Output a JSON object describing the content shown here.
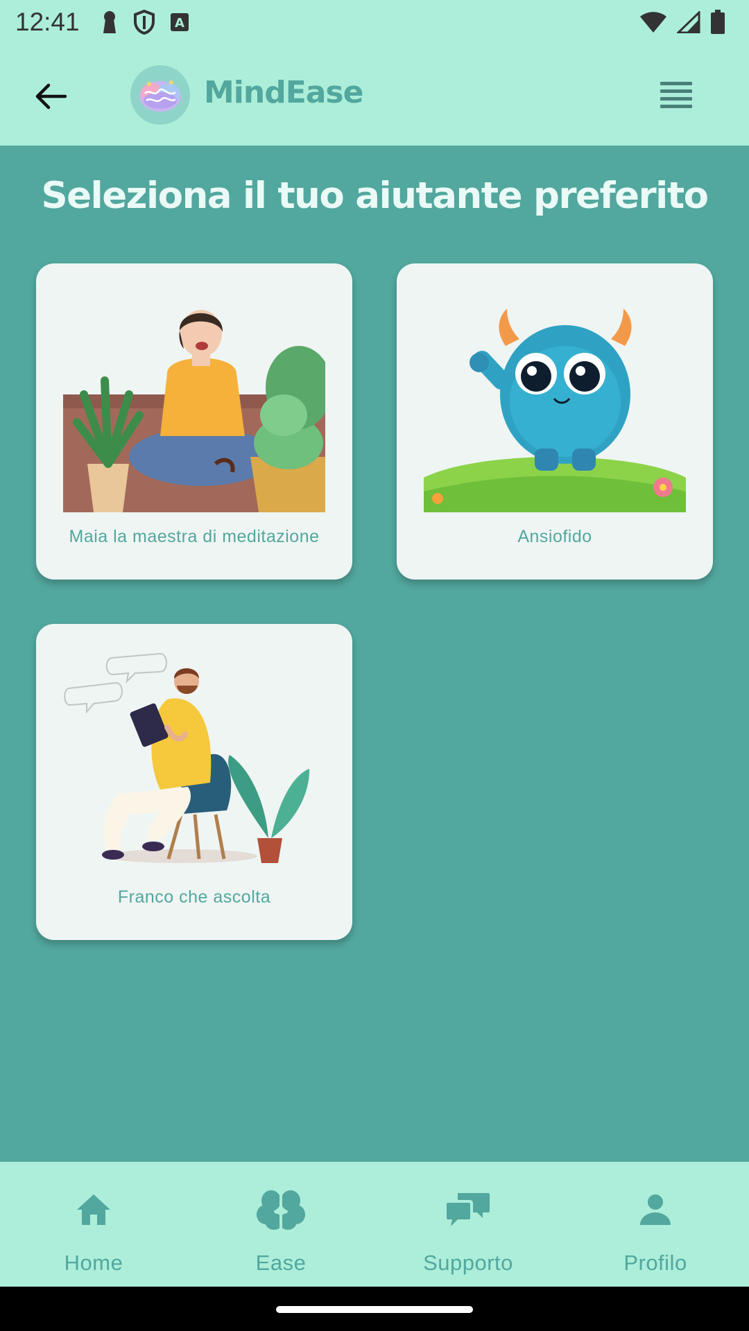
{
  "status_bar": {
    "time": "12:41",
    "icons_left": [
      "keyhole-icon",
      "shield-icon",
      "a-badge-icon"
    ],
    "icons_right": [
      "wifi-icon",
      "signal-icon",
      "battery-icon"
    ]
  },
  "app_bar": {
    "title": "MindEase",
    "back_icon": "arrow-left-icon",
    "menu_icon": "menu-icon",
    "logo_icon": "brain-logo-icon"
  },
  "main": {
    "title": "Seleziona il tuo aiutante preferito",
    "helpers": [
      {
        "label": "Maia la maestra di meditazione",
        "image": "meditating-woman"
      },
      {
        "label": "Ansiofido",
        "image": "blue-monster"
      },
      {
        "label": "Franco che ascolta",
        "image": "listening-man"
      }
    ]
  },
  "bottom_nav": {
    "items": [
      {
        "label": "Home",
        "icon": "home-icon"
      },
      {
        "label": "Ease",
        "icon": "brain-icon"
      },
      {
        "label": "Supporto",
        "icon": "chat-icon"
      },
      {
        "label": "Profilo",
        "icon": "person-icon"
      }
    ]
  },
  "colors": {
    "header_bg": "#aceed9",
    "page_bg": "#52a79e",
    "card_bg": "#eff5f3",
    "accent": "#52a79e"
  }
}
